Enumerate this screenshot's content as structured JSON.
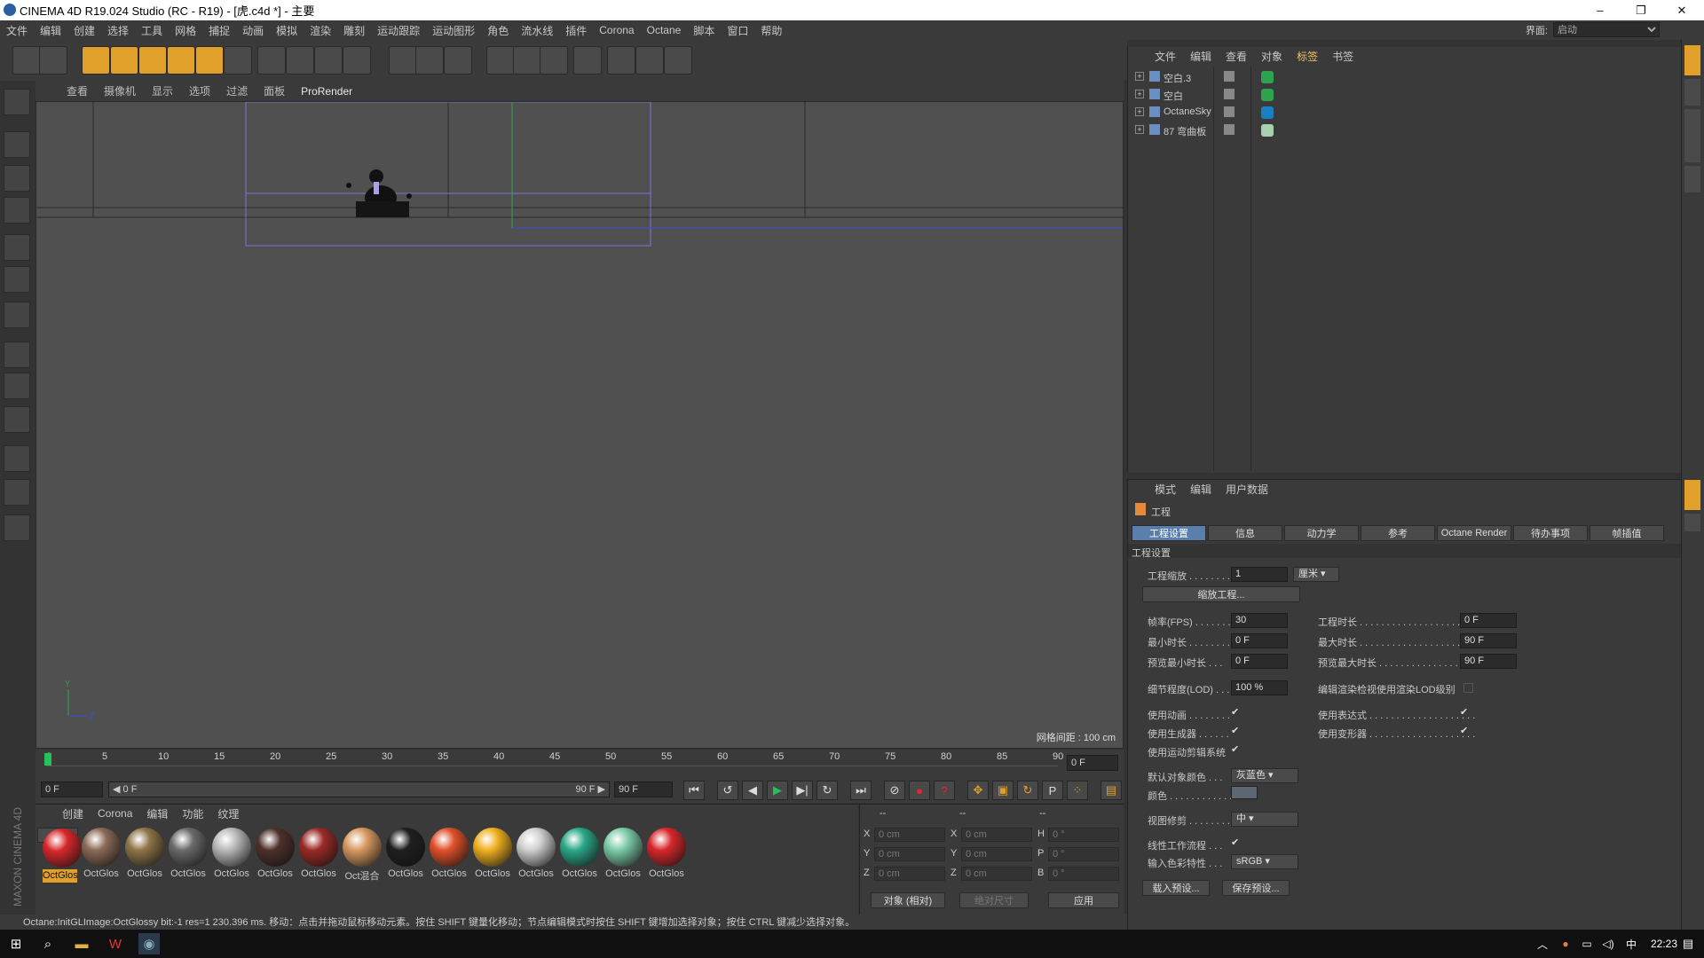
{
  "window": {
    "title": "CINEMA 4D R19.024 Studio (RC - R19) - [虎.c4d *] - 主要",
    "minimize": "–",
    "restore": "❐",
    "close": "✕"
  },
  "menubar": [
    "文件",
    "编辑",
    "创建",
    "选择",
    "工具",
    "网格",
    "捕捉",
    "动画",
    "模拟",
    "渲染",
    "雕刻",
    "运动跟踪",
    "运动图形",
    "角色",
    "流水线",
    "插件",
    "Corona",
    "Octane",
    "脚本",
    "窗口",
    "帮助"
  ],
  "interface": {
    "label": "界面:",
    "value": "启动"
  },
  "viewport": {
    "menu": [
      "查看",
      "摄像机",
      "显示",
      "选项",
      "过滤",
      "面板",
      "ProRender"
    ],
    "grid_spacing": "网格间距 : 100 cm",
    "axis": {
      "y": "Y",
      "z": "Z"
    }
  },
  "timeline": {
    "ticks": [
      "0",
      "5",
      "10",
      "15",
      "20",
      "25",
      "30",
      "35",
      "40",
      "45",
      "50",
      "55",
      "60",
      "65",
      "70",
      "75",
      "80",
      "85",
      "90"
    ],
    "current_frame": "0 F",
    "start": "0 F",
    "range_start": "◀ 0 F",
    "range_end": "90 F ▶",
    "end": "90 F"
  },
  "materials": {
    "menu": [
      "创建",
      "Corona",
      "编辑",
      "功能",
      "纹理"
    ],
    "items": [
      {
        "label": "OctGlos",
        "color": "#d8272b"
      },
      {
        "label": "OctGlos",
        "color": "#8a6a56"
      },
      {
        "label": "OctGlos",
        "color": "#8e7448"
      },
      {
        "label": "OctGlos",
        "color": "#6a6a6a"
      },
      {
        "label": "OctGlos",
        "color": "#b9b9b9"
      },
      {
        "label": "OctGlos",
        "color": "#4e302a"
      },
      {
        "label": "OctGlos",
        "color": "#9a2a24"
      },
      {
        "label": "Oct混合",
        "color": "#d89a60"
      },
      {
        "label": "OctGlos",
        "color": "#1f1f1f"
      },
      {
        "label": "OctGlos",
        "color": "#e0502a"
      },
      {
        "label": "OctGlos",
        "color": "#f0b020"
      },
      {
        "label": "OctGlos",
        "color": "#d0d0d0"
      },
      {
        "label": "OctGlos",
        "color": "#2aa888"
      },
      {
        "label": "OctGlos",
        "color": "#7ccca8"
      },
      {
        "label": "OctGlos",
        "color": "#d8272b"
      }
    ],
    "brand": "MAXON CINEMA 4D"
  },
  "coords": {
    "headers": [
      "--",
      "--",
      "--"
    ],
    "rows": [
      {
        "a": "X",
        "av": "0 cm",
        "b": "X",
        "bv": "0 cm",
        "c": "H",
        "cv": "0 °"
      },
      {
        "a": "Y",
        "av": "0 cm",
        "b": "Y",
        "bv": "0 cm",
        "c": "P",
        "cv": "0 °"
      },
      {
        "a": "Z",
        "av": "0 cm",
        "b": "Z",
        "bv": "0 cm",
        "c": "B",
        "cv": "0 °"
      }
    ],
    "mode": "对象 (相对)",
    "size_mode": "绝对尺寸",
    "apply": "应用"
  },
  "status": {
    "text": "Octane:InitGLImage:OctGlossy  bit:-1 res=1  230.396 ms.      移动：点击并拖动鼠标移动元素。按住 SHIFT 键量化移动；节点编辑模式时按住 SHIFT 键增加选择对象；按住 CTRL 键减少选择对象。"
  },
  "objects": {
    "menu": [
      "文件",
      "编辑",
      "查看",
      "对象",
      "标签",
      "书签"
    ],
    "items": [
      {
        "name": "空白.3"
      },
      {
        "name": "空白"
      },
      {
        "name": "OctaneSky"
      },
      {
        "name": "87 弯曲板"
      }
    ]
  },
  "attributes": {
    "menu": [
      "模式",
      "编辑",
      "用户数据"
    ],
    "title": "工程",
    "tabs": [
      "工程设置",
      "信息",
      "动力学",
      "参考",
      "Octane Render",
      "待办事项",
      "帧插值"
    ],
    "section": "工程设置",
    "scale_label": "工程缩放 . . . . . . . .",
    "scale_value": "1",
    "scale_unit": "厘米",
    "scale_btn": "缩放工程...",
    "fps_label": "帧率(FPS) . . . . . . .",
    "fps": "30",
    "duration_label": "工程时长 . . . . . . . . . . . . . . . . . . . . .",
    "duration": "0 F",
    "min_label": "最小时长 . . . . . . . .",
    "min": "0 F",
    "max_label": "最大时长 . . . . . . . . . . . . . . . . . . . . .",
    "max": "90 F",
    "pmin_label": "预览最小时长 . . .",
    "pmin": "0 F",
    "pmax_label": "预览最大时长 . . . . . . . . . . . . . . . . .",
    "pmax": "90 F",
    "lod_label": "细节程度(LOD) . . .",
    "lod": "100 %",
    "lod_render_label": "编辑渲染检视使用渲染LOD级别",
    "anim_label": "使用动画 . . . . . . . .",
    "expr_label": "使用表达式 . . . . . . . . . . . . . . . . . . . .",
    "gen_label": "使用生成器 . . . . . .",
    "deform_label": "使用变形器 . . . . . . . . . . . . . . . . . . . .",
    "mograph_label": "使用运动剪辑系统",
    "defcolor_label": "默认对象颜色 . . .",
    "defcolor": "灰蓝色",
    "color_label": "颜色 . . . . . . . . . . . .",
    "clip_label": "视图修剪 . . . . . . . .",
    "clip": "中",
    "linear_label": "线性工作流程 . . .",
    "input_label": "输入色彩特性 . . .",
    "input": "sRGB",
    "load_preset": "载入预设...",
    "save_preset": "保存预设..."
  },
  "taskbar": {
    "time": "22:23"
  }
}
